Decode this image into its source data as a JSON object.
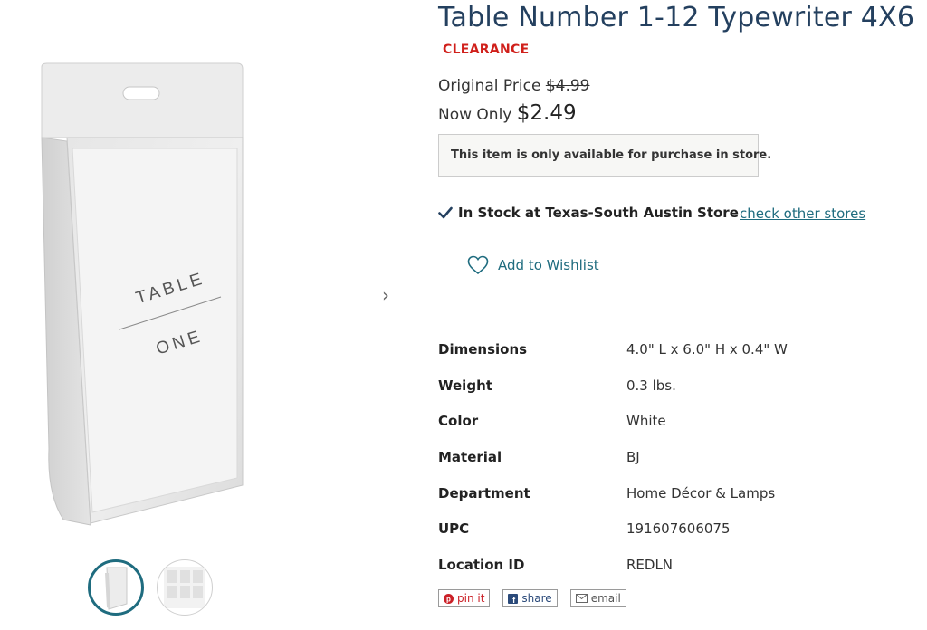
{
  "product": {
    "title": "Table Number 1-12 Typewriter 4X6",
    "badge": "CLEARANCE",
    "original_price_label": "Original Price",
    "original_price": "$4.99",
    "now_label": "Now Only",
    "now_price": "$2.49",
    "store_notice": "This item is only available for purchase in store.",
    "stock_status": "In Stock at Texas-South Austin Store",
    "check_other_stores": "check other stores",
    "wishlist_label": "Add to Wishlist",
    "image_text": {
      "line1": "TABLE",
      "line2": "ONE"
    }
  },
  "specs": [
    {
      "label": "Dimensions",
      "value": "4.0\" L x 6.0\" H x 0.4\" W"
    },
    {
      "label": "Weight",
      "value": "0.3 lbs."
    },
    {
      "label": "Color",
      "value": "White"
    },
    {
      "label": "Material",
      "value": "BJ"
    },
    {
      "label": "Department",
      "value": "Home Décor & Lamps"
    },
    {
      "label": "UPC",
      "value": "191607606075"
    },
    {
      "label": "Location ID",
      "value": "REDLN"
    }
  ],
  "share": {
    "pin": "pin it",
    "facebook": "share",
    "email": "email"
  },
  "icons": {
    "next": "chevron-right-icon",
    "check": "checkmark-icon",
    "wishlist": "heart-outline-icon",
    "pinterest": "pinterest-icon",
    "facebook": "facebook-icon",
    "email": "envelope-icon"
  },
  "colors": {
    "title": "#24405f",
    "clearance": "#d0201b",
    "link": "#1f6c7f",
    "pinterest": "#cb2027",
    "facebook": "#2b4a7a"
  }
}
